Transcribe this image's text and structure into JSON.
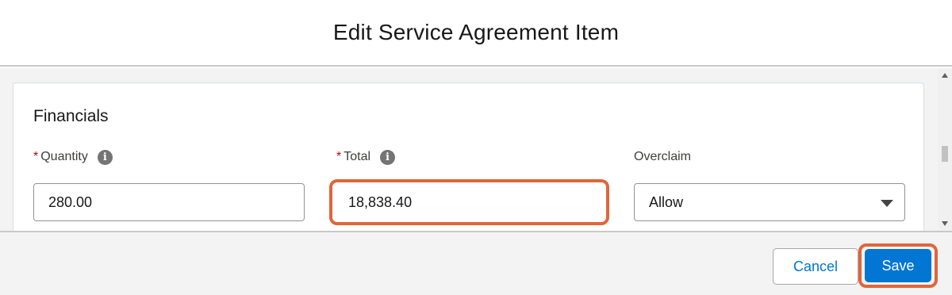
{
  "modal": {
    "title": "Edit Service Agreement Item"
  },
  "section": {
    "title": "Financials"
  },
  "fields": {
    "quantity": {
      "label": "Quantity",
      "required_marker": "*",
      "info_icon": "i",
      "value": "280.00"
    },
    "total": {
      "label": "Total",
      "required_marker": "*",
      "info_icon": "i",
      "value": "18,838.40"
    },
    "overclaim": {
      "label": "Overclaim",
      "value": "Allow"
    }
  },
  "footer": {
    "cancel_label": "Cancel",
    "save_label": "Save"
  },
  "colors": {
    "accent": "#0176d3",
    "highlight": "#e0663a",
    "required": "#ba0517"
  }
}
